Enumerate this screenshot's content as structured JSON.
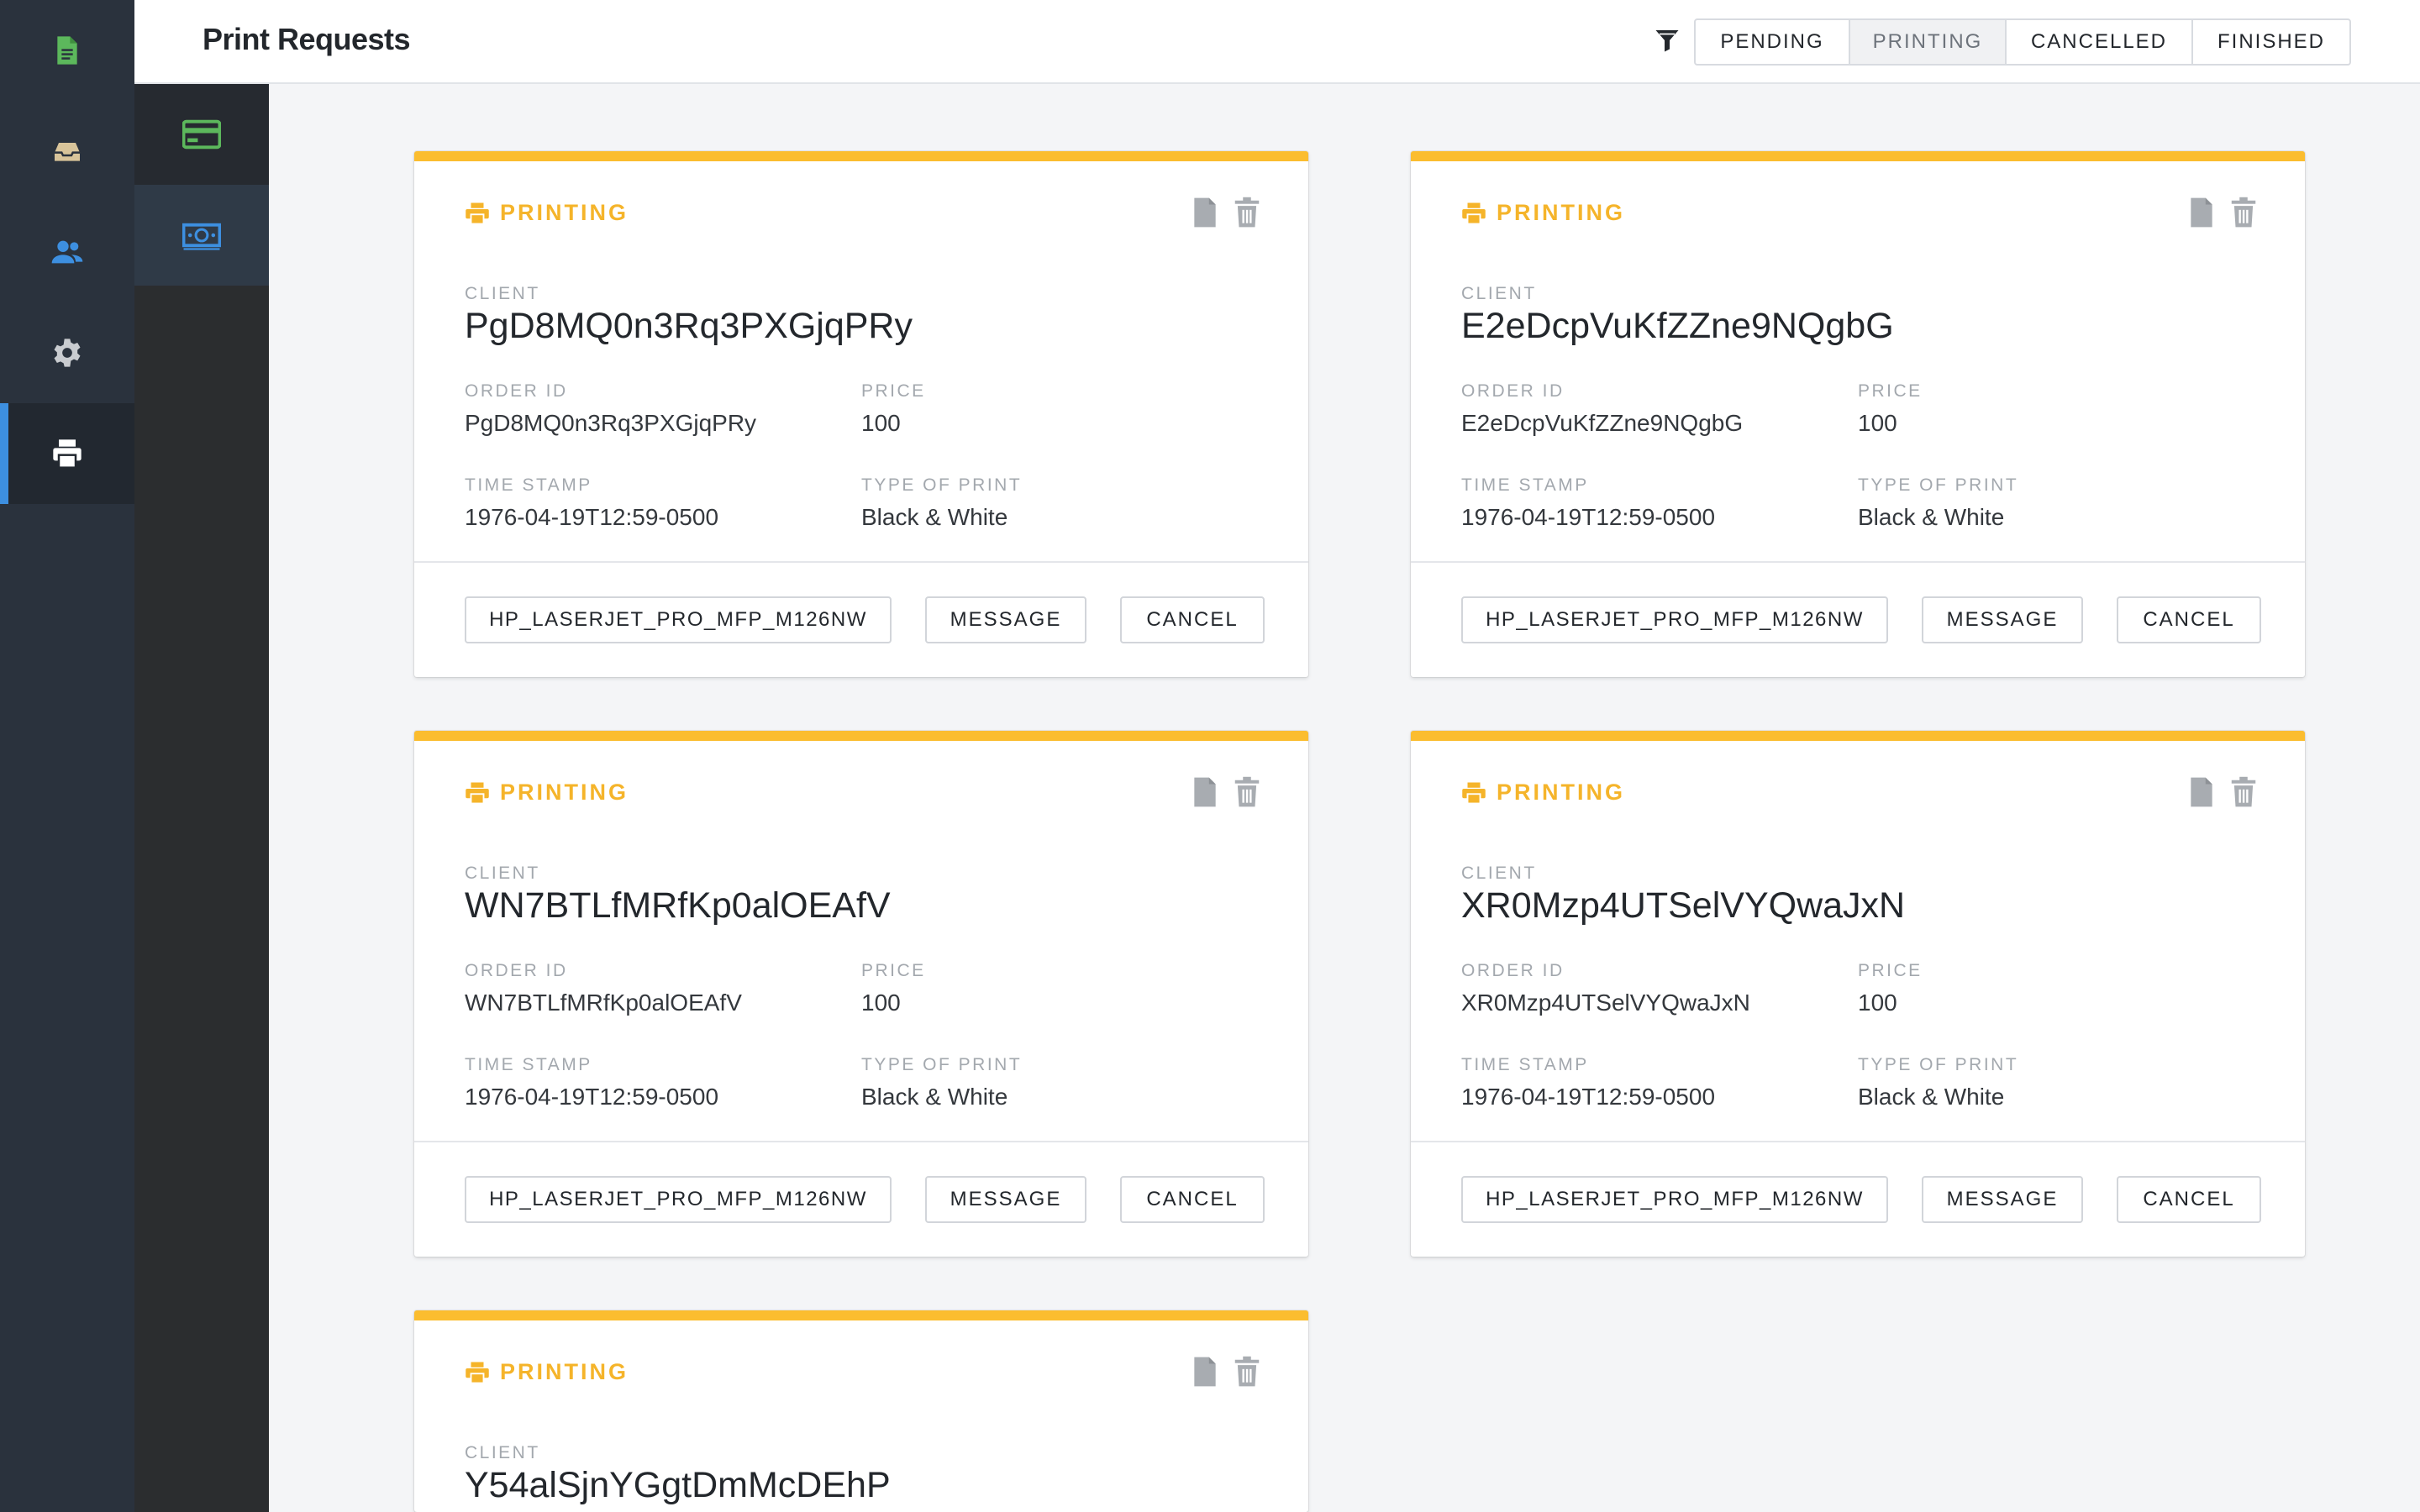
{
  "app": {
    "page_title": "Print Requests"
  },
  "nav": {
    "items": [
      {
        "icon": "document-icon",
        "color": "#5cb85c"
      },
      {
        "icon": "inbox-icon",
        "color": "#d8c49a"
      },
      {
        "icon": "users-icon",
        "color": "#3d8fe0"
      },
      {
        "icon": "gear-icon",
        "color": "#c9ccd0"
      },
      {
        "icon": "printer-icon",
        "color": "#ffffff",
        "active": true
      }
    ],
    "sub_items": [
      {
        "icon": "credit-card-icon",
        "color": "#5cb85c"
      },
      {
        "icon": "money-icon",
        "color": "#3d8fe0"
      }
    ]
  },
  "filters": {
    "tabs": [
      "PENDING",
      "PRINTING",
      "CANCELLED",
      "FINISHED"
    ],
    "selected": "PRINTING"
  },
  "labels": {
    "client": "CLIENT",
    "order_id": "ORDER ID",
    "price": "PRICE",
    "time_stamp": "TIME STAMP",
    "type_of_print": "TYPE OF PRINT",
    "message": "MESSAGE",
    "cancel": "CANCEL"
  },
  "colors": {
    "accent": "#fbbd2f",
    "status": "#f5b42a",
    "active_indicator": "#3d8fe0"
  },
  "cards": [
    {
      "status": "PRINTING",
      "client": "PgD8MQ0n3Rq3PXGjqPRy",
      "order_id": "PgD8MQ0n3Rq3PXGjqPRy",
      "price": "100",
      "time_stamp": "1976-04-19T12:59-0500",
      "type_of_print": "Black & White",
      "printer": "HP_LASERJET_PRO_MFP_M126NW"
    },
    {
      "status": "PRINTING",
      "client": "E2eDcpVuKfZZne9NQgbG",
      "order_id": "E2eDcpVuKfZZne9NQgbG",
      "price": "100",
      "time_stamp": "1976-04-19T12:59-0500",
      "type_of_print": "Black & White",
      "printer": "HP_LASERJET_PRO_MFP_M126NW"
    },
    {
      "status": "PRINTING",
      "client": "WN7BTLfMRfKp0alOEAfV",
      "order_id": "WN7BTLfMRfKp0alOEAfV",
      "price": "100",
      "time_stamp": "1976-04-19T12:59-0500",
      "type_of_print": "Black & White",
      "printer": "HP_LASERJET_PRO_MFP_M126NW"
    },
    {
      "status": "PRINTING",
      "client": "XR0Mzp4UTSelVYQwaJxN",
      "order_id": "XR0Mzp4UTSelVYQwaJxN",
      "price": "100",
      "time_stamp": "1976-04-19T12:59-0500",
      "type_of_print": "Black & White",
      "printer": "HP_LASERJET_PRO_MFP_M126NW"
    },
    {
      "status": "PRINTING",
      "client": "Y54alSjnYGgtDmMcDEhP"
    }
  ]
}
